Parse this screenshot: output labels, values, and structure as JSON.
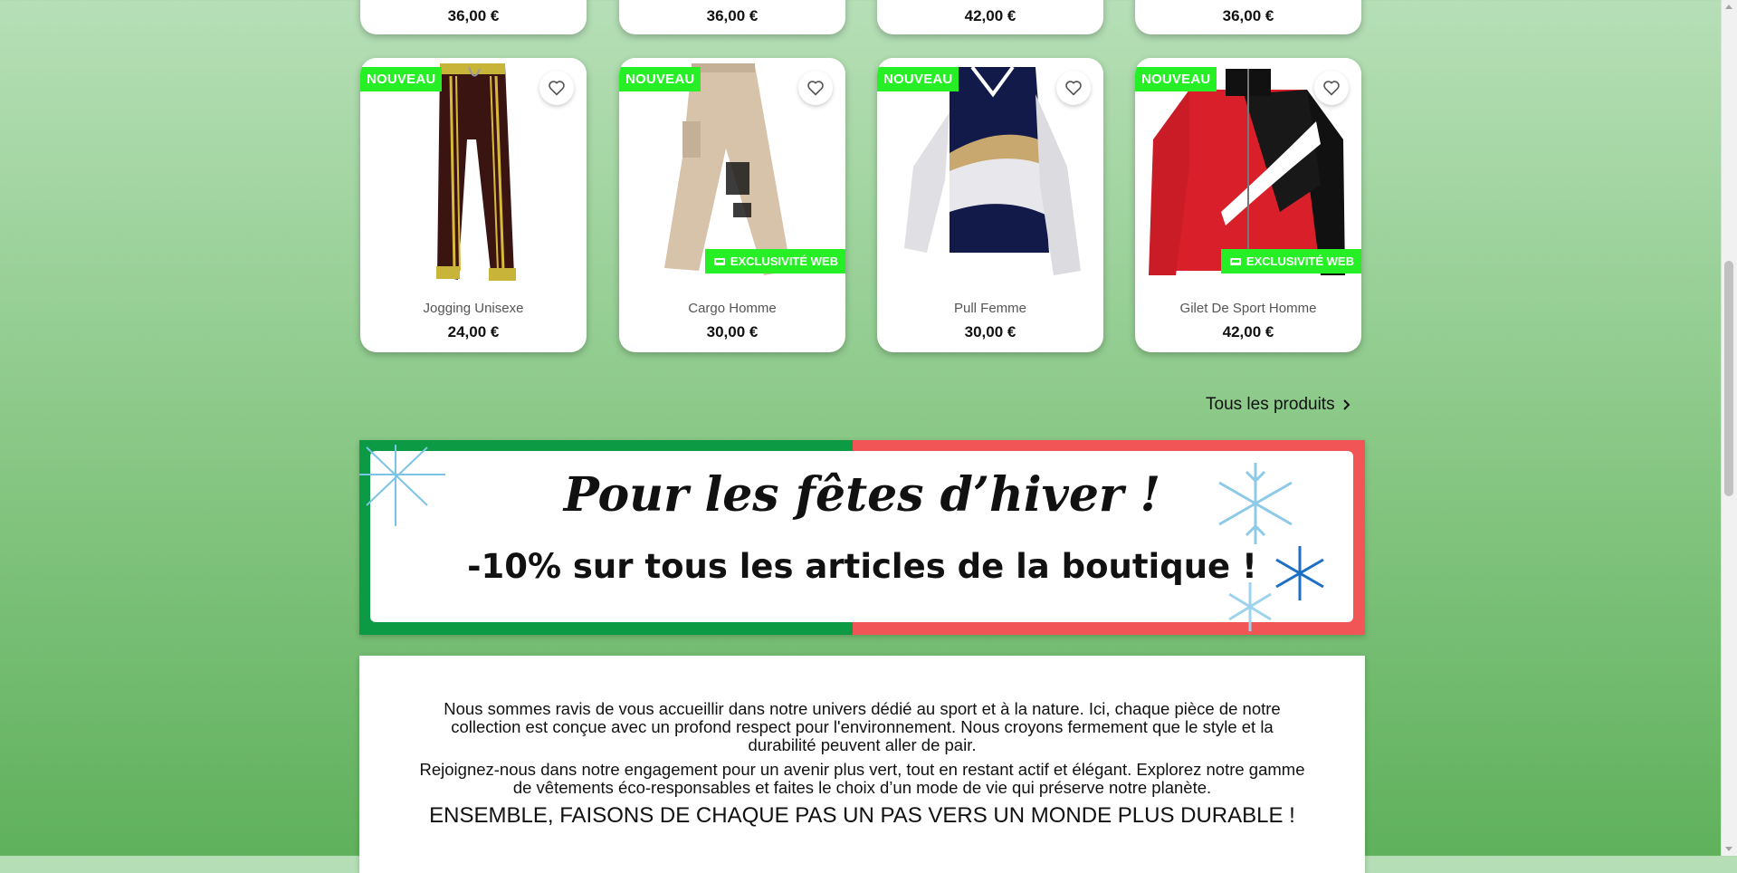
{
  "top_row": [
    {
      "price": "36,00 €"
    },
    {
      "price": "36,00 €"
    },
    {
      "price": "42,00 €"
    },
    {
      "price": "36,00 €"
    }
  ],
  "products": [
    {
      "name": "Jogging Unisexe",
      "price": "24,00 €",
      "badge_new": "NOUVEAU",
      "badge_web": ""
    },
    {
      "name": "Cargo Homme",
      "price": "30,00 €",
      "badge_new": "NOUVEAU",
      "badge_web": "EXCLUSIVITÉ WEB"
    },
    {
      "name": "Pull Femme",
      "price": "30,00 €",
      "badge_new": "NOUVEAU",
      "badge_web": ""
    },
    {
      "name": "Gilet De Sport Homme",
      "price": "42,00 €",
      "badge_new": "NOUVEAU",
      "badge_web": "EXCLUSIVITÉ WEB"
    }
  ],
  "all_products_link": "Tous les produits",
  "banner": {
    "title": "Pour les fêtes d’hiver !",
    "subtitle": "-10% sur tous les articles de la boutique !"
  },
  "about": {
    "p1": "Nous sommes ravis de vous accueillir dans notre univers dédié au sport et à la nature. Ici, chaque pièce de notre collection est conçue avec un profond respect pour l'environnement. Nous croyons fermement que le style et la durabilité peuvent aller de pair.",
    "p2": "Rejoignez-nous dans notre engagement pour un avenir plus vert, tout en restant actif et élégant. Explorez notre gamme de vêtements éco-responsables et faites le choix d’un mode de vie qui préserve notre planète.",
    "p3": "ENSEMBLE, FAISONS DE CHAQUE PAS UN PAS VERS UN MONDE PLUS DURABLE !"
  },
  "colors": {
    "badge_green": "#26ef26",
    "banner_green": "#0d9a45",
    "banner_red": "#f15555"
  }
}
